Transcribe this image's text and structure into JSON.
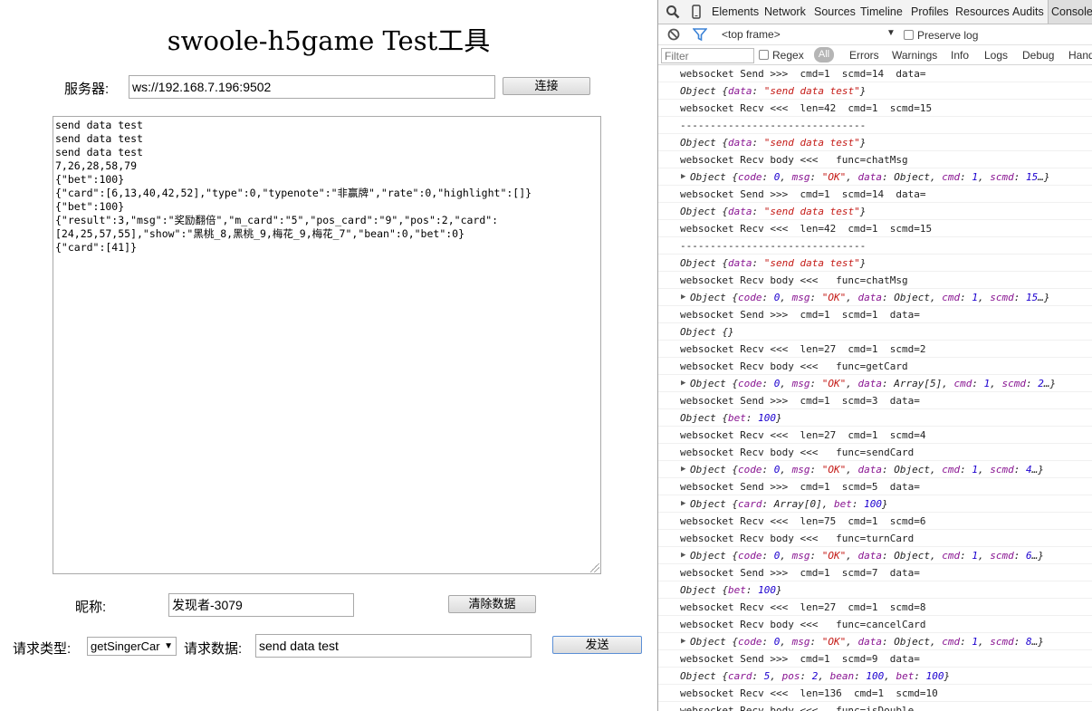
{
  "page": {
    "title": "swoole-h5game Test工具",
    "server_label": "服务器:",
    "server_value": "ws://192.168.7.196:9502",
    "connect_button": "连接",
    "output": "send data test\nsend data test\nsend data test\n7,26,28,58,79\n{\"bet\":100}\n{\"card\":[6,13,40,42,52],\"type\":0,\"typenote\":\"非赢牌\",\"rate\":0,\"highlight\":[]}\n{\"bet\":100}\n{\"result\":3,\"msg\":\"奖励翻倍\",\"m_card\":\"5\",\"pos_card\":\"9\",\"pos\":2,\"card\":\n[24,25,57,55],\"show\":\"黑桃_8,黑桃_9,梅花_9,梅花_7\",\"bean\":0,\"bet\":0}\n{\"card\":[41]}",
    "nickname_label": "昵称:",
    "nickname_value": "发现者-3079",
    "clear_button": "清除数据",
    "request_type_label": "请求类型:",
    "request_type_value": "getSingerCar",
    "request_data_label": "请求数据:",
    "request_data_value": "send data test",
    "send_button": "发送"
  },
  "devtools": {
    "tabs": [
      "Elements",
      "Network",
      "Sources",
      "Timeline",
      "Profiles",
      "Resources",
      "Audits",
      "Console"
    ],
    "selected_tab": "Console",
    "frame_select": "<top frame>",
    "preserve_log": "Preserve log",
    "filter_placeholder": "Filter",
    "regex": "Regex",
    "all": "All",
    "levels": [
      "Errors",
      "Warnings",
      "Info",
      "Logs",
      "Debug",
      "Handled"
    ],
    "console_lines": [
      {
        "kind": "plain",
        "text": "websocket Send >>>  cmd=1  scmd=14  data="
      },
      {
        "kind": "obj",
        "text": "Object {data: \"send data test\"}"
      },
      {
        "kind": "plain",
        "text": "websocket Recv <<<  len=42  cmd=1  scmd=15"
      },
      {
        "kind": "plain",
        "text": "-------------------------------"
      },
      {
        "kind": "obj",
        "text": "Object {data: \"send data test\"}"
      },
      {
        "kind": "plain",
        "text": "websocket Recv body <<<   func=chatMsg"
      },
      {
        "kind": "exp",
        "text": "Object {code: 0, msg: \"OK\", data: Object, cmd: 1, scmd: 15…}"
      },
      {
        "kind": "plain",
        "text": "websocket Send >>>  cmd=1  scmd=14  data="
      },
      {
        "kind": "obj",
        "text": "Object {data: \"send data test\"}"
      },
      {
        "kind": "plain",
        "text": "websocket Recv <<<  len=42  cmd=1  scmd=15"
      },
      {
        "kind": "plain",
        "text": "-------------------------------"
      },
      {
        "kind": "obj",
        "text": "Object {data: \"send data test\"}"
      },
      {
        "kind": "plain",
        "text": "websocket Recv body <<<   func=chatMsg"
      },
      {
        "kind": "exp",
        "text": "Object {code: 0, msg: \"OK\", data: Object, cmd: 1, scmd: 15…}"
      },
      {
        "kind": "plain",
        "text": "websocket Send >>>  cmd=1  scmd=1  data="
      },
      {
        "kind": "obj",
        "text": "Object {}"
      },
      {
        "kind": "plain",
        "text": "websocket Recv <<<  len=27  cmd=1  scmd=2"
      },
      {
        "kind": "plain",
        "text": "websocket Recv body <<<   func=getCard"
      },
      {
        "kind": "exp",
        "text": "Object {code: 0, msg: \"OK\", data: Array[5], cmd: 1, scmd: 2…}"
      },
      {
        "kind": "plain",
        "text": "websocket Send >>>  cmd=1  scmd=3  data="
      },
      {
        "kind": "obj",
        "text": "Object {bet: 100}"
      },
      {
        "kind": "plain",
        "text": "websocket Recv <<<  len=27  cmd=1  scmd=4"
      },
      {
        "kind": "plain",
        "text": "websocket Recv body <<<   func=sendCard"
      },
      {
        "kind": "exp",
        "text": "Object {code: 0, msg: \"OK\", data: Object, cmd: 1, scmd: 4…}"
      },
      {
        "kind": "plain",
        "text": "websocket Send >>>  cmd=1  scmd=5  data="
      },
      {
        "kind": "exp",
        "text": "Object {card: Array[0], bet: 100}"
      },
      {
        "kind": "plain",
        "text": "websocket Recv <<<  len=75  cmd=1  scmd=6"
      },
      {
        "kind": "plain",
        "text": "websocket Recv body <<<   func=turnCard"
      },
      {
        "kind": "exp",
        "text": "Object {code: 0, msg: \"OK\", data: Object, cmd: 1, scmd: 6…}"
      },
      {
        "kind": "plain",
        "text": "websocket Send >>>  cmd=1  scmd=7  data="
      },
      {
        "kind": "obj",
        "text": "Object {bet: 100}"
      },
      {
        "kind": "plain",
        "text": "websocket Recv <<<  len=27  cmd=1  scmd=8"
      },
      {
        "kind": "plain",
        "text": "websocket Recv body <<<   func=cancelCard"
      },
      {
        "kind": "exp",
        "text": "Object {code: 0, msg: \"OK\", data: Object, cmd: 1, scmd: 8…}"
      },
      {
        "kind": "plain",
        "text": "websocket Send >>>  cmd=1  scmd=9  data="
      },
      {
        "kind": "obj",
        "text": "Object {card: 5, pos: 2, bean: 100, bet: 100}"
      },
      {
        "kind": "plain",
        "text": "websocket Recv <<<  len=136  cmd=1  scmd=10"
      },
      {
        "kind": "plain",
        "text": "websocket Recv body <<<   func=isDouble"
      }
    ]
  }
}
